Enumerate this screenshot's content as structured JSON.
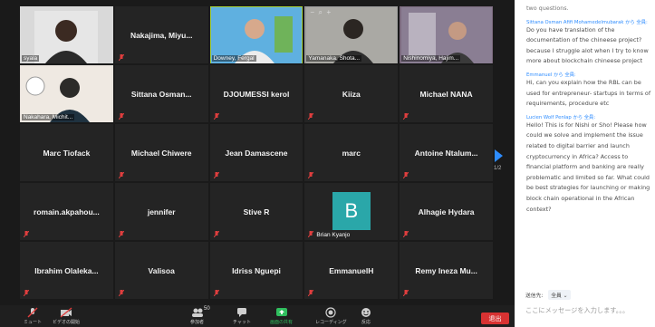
{
  "video_tiles": [
    {
      "name": "syala"
    },
    {
      "name": "Nakajima,  Miyu..."
    },
    {
      "name": "Downey, Fergal"
    },
    {
      "name": "Yamanaka, Shota..."
    },
    {
      "name": "Nishinomiya, Hajim..."
    },
    {
      "name": "Nakahara, Michit..."
    },
    {
      "name": "Sittana  Osman..."
    },
    {
      "name": "DJOUMESSI kerol"
    },
    {
      "name": "Kiiza"
    },
    {
      "name": "Michael NANA"
    },
    {
      "name": "Marc Tiofack"
    },
    {
      "name": "Michael Chiwere"
    },
    {
      "name": "Jean Damascene"
    },
    {
      "name": "marc"
    },
    {
      "name": "Antoine  Ntalum..."
    },
    {
      "name": "romain.akpahou..."
    },
    {
      "name": "jennifer"
    },
    {
      "name": "Stive R"
    },
    {
      "name": "Brian Kyanjo",
      "avatar_letter": "B"
    },
    {
      "name": "Alhagie Hydara"
    },
    {
      "name": "Ibrahim  Olaleka..."
    },
    {
      "name": "Valisoa"
    },
    {
      "name": "Idriss Nguepi"
    },
    {
      "name": "EmmanuelH"
    },
    {
      "name": "Remy Ineza Mu..."
    }
  ],
  "zoom_controls": {
    "minus": "−",
    "zoom": "⌕",
    "plus": "+"
  },
  "pager": {
    "page": "1/2"
  },
  "toolbar": {
    "participants_count": "50",
    "items": [
      {
        "label": "ミュート"
      },
      {
        "label": "ビデオの開始"
      },
      {
        "label": "参加者"
      },
      {
        "label": "チャット"
      },
      {
        "label": "画面の共有"
      },
      {
        "label": "レコーディング"
      },
      {
        "label": "反応"
      }
    ],
    "leave": "退出"
  },
  "chat": {
    "messages": [
      {
        "sender": "",
        "text": "two questions."
      },
      {
        "sender": "Sittana Osman Afifi Mohamedelmubarak から 全員:",
        "text": "Do you have translation of the documentation of the chineese project? because I struggle alot when I try to know more about blockchain chineese project"
      },
      {
        "sender": "Emmanuel から 全員:",
        "text": "Hi, can you explain how the RBL can be used for entrepreneur- startups in terms of requirements, procedure etc"
      },
      {
        "sender": "Lucien Wolf Penlap から 全員:",
        "text": "Hello! This is for Nishi or Sho! Please how could we solve and implement the issue related to digital barrier and launch cryptocurrency in Africa? Access to financial platform and banking are really problematic and limited so far. What could be best strategies for launching or making block chain operational in the African context?"
      }
    ],
    "to_label": "送信先:",
    "to_value": "全員",
    "placeholder": "ここにメッセージを入力します。。。"
  },
  "colors": {
    "active_speaker": "#a7d13a",
    "chat_sender": "#2d8cff",
    "leave": "#d83232",
    "avatar": "#2aa7a9"
  }
}
